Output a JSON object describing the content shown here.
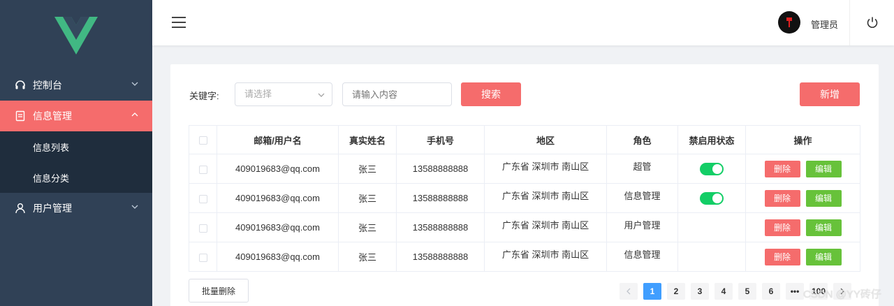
{
  "sidebar": {
    "menu": [
      {
        "label": "控制台",
        "icon": "headset-icon",
        "expanded": false
      },
      {
        "label": "信息管理",
        "icon": "document-icon",
        "expanded": true,
        "active": true,
        "children": [
          {
            "label": "信息列表"
          },
          {
            "label": "信息分类"
          }
        ]
      },
      {
        "label": "用户管理",
        "icon": "user-icon",
        "expanded": false
      }
    ]
  },
  "header": {
    "username": "管理员"
  },
  "search": {
    "keyword_label": "关键字:",
    "select_placeholder": "请选择",
    "input_placeholder": "请输入内容",
    "search_button": "搜索",
    "add_button": "新增"
  },
  "table": {
    "columns": [
      "邮箱/用户名",
      "真实姓名",
      "手机号",
      "地区",
      "角色",
      "禁启用状态",
      "操作"
    ],
    "delete_label": "删除",
    "edit_label": "编辑",
    "rows": [
      {
        "email": "409019683@qq.com",
        "name": "张三",
        "phone": "13588888888",
        "region": "广东省 深圳市 南山区",
        "role": "超管",
        "enabled": true
      },
      {
        "email": "409019683@qq.com",
        "name": "张三",
        "phone": "13588888888",
        "region": "广东省 深圳市 南山区",
        "role": "信息管理",
        "enabled": true
      },
      {
        "email": "409019683@qq.com",
        "name": "张三",
        "phone": "13588888888",
        "region": "广东省 深圳市 南山区",
        "role": "用户管理",
        "enabled": null
      },
      {
        "email": "409019683@qq.com",
        "name": "张三",
        "phone": "13588888888",
        "region": "广东省 深圳市 南山区",
        "role": "信息管理",
        "enabled": null
      }
    ]
  },
  "footer": {
    "batch_delete": "批量删除",
    "pages": [
      "1",
      "2",
      "3",
      "4",
      "5",
      "6",
      "•••",
      "100"
    ],
    "current_page": "1"
  },
  "watermark": "CSDN @YY砖仔",
  "colors": {
    "sidebar_bg": "#304156",
    "accent_red": "#f56c6c",
    "edit_green": "#67c23a",
    "switch_on": "#13ce66",
    "page_active": "#409eff"
  }
}
